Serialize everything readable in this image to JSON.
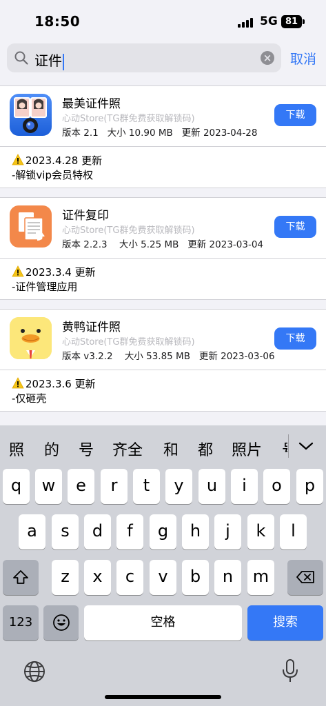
{
  "status": {
    "time": "18:50",
    "network": "5G",
    "battery": "81"
  },
  "search": {
    "query": "证件",
    "cancel_label": "取消"
  },
  "results": [
    {
      "name": "最美证件照",
      "source": "心动Store(TG群免费获取解锁码)",
      "version_label": "版本 2.1",
      "size_label": "大小 10.90 MB",
      "update_label": "更新 2023-04-28",
      "button": "下载",
      "note_title": "2023.4.28 更新",
      "note_body": "-解锁vip会员特权",
      "icon": "photo-portrait-camera-icon"
    },
    {
      "name": "证件复印",
      "source": "心动Store(TG群免费获取解锁码)",
      "version_label": "版本 2.2.3",
      "size_label": "大小 5.25 MB",
      "update_label": "更新 2023-03-04",
      "button": "下载",
      "note_title": "2023.3.4 更新",
      "note_body": "-证件管理应用",
      "icon": "document-copy-icon"
    },
    {
      "name": "黄鸭证件照",
      "source": "心动Store(TG群免费获取解锁码)",
      "version_label": "版本 v3.2.2",
      "size_label": "大小 53.85 MB",
      "update_label": "更新 2023-03-06",
      "button": "下载",
      "note_title": "2023.3.6 更新",
      "note_body": "-仅砸壳",
      "icon": "yellow-duck-icon"
    }
  ],
  "keyboard": {
    "candidates": [
      "照",
      "的",
      "号",
      "齐全",
      "和",
      "都",
      "照片",
      "号"
    ],
    "row1": [
      "q",
      "w",
      "e",
      "r",
      "t",
      "y",
      "u",
      "i",
      "o",
      "p"
    ],
    "row2": [
      "a",
      "s",
      "d",
      "f",
      "g",
      "h",
      "j",
      "k",
      "l"
    ],
    "row3": [
      "z",
      "x",
      "c",
      "v",
      "b",
      "n",
      "m"
    ],
    "num_label": "123",
    "space_label": "空格",
    "search_label": "搜索"
  },
  "colors": {
    "accent": "#3478f6",
    "keyboard_bg": "#d1d3d9",
    "page_bg": "#f2f2f7"
  }
}
